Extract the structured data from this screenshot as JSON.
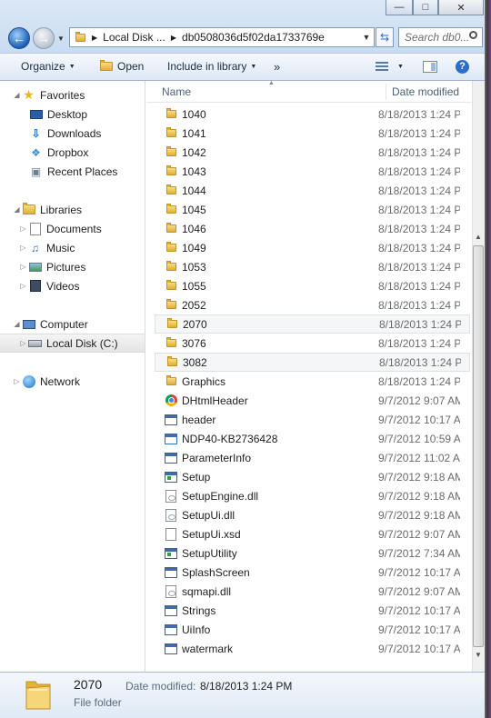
{
  "window": {
    "minimize_label": "—",
    "maximize_label": "□",
    "close_label": "✕"
  },
  "address": {
    "crumbs": [
      "Local Disk ...",
      "db0508036d5f02da1733769e"
    ],
    "separator": "▶",
    "refresh_icon": "⇆"
  },
  "search": {
    "placeholder": "Search db0..."
  },
  "toolbar": {
    "organize_label": "Organize",
    "open_label": "Open",
    "include_label": "Include in library",
    "more_label": "»"
  },
  "nav": {
    "favorites": {
      "label": "Favorites",
      "items": [
        "Desktop",
        "Downloads",
        "Dropbox",
        "Recent Places"
      ]
    },
    "libraries": {
      "label": "Libraries",
      "items": [
        "Documents",
        "Music",
        "Pictures",
        "Videos"
      ]
    },
    "computer": {
      "label": "Computer",
      "items": [
        "Local Disk (C:)"
      ]
    },
    "network": {
      "label": "Network"
    }
  },
  "columns": {
    "name": "Name",
    "date": "Date modified"
  },
  "files": [
    {
      "name": "1040",
      "date": "8/18/2013 1:24 P",
      "icon": "folder-icon"
    },
    {
      "name": "1041",
      "date": "8/18/2013 1:24 P",
      "icon": "folder-icon"
    },
    {
      "name": "1042",
      "date": "8/18/2013 1:24 P",
      "icon": "folder-icon"
    },
    {
      "name": "1043",
      "date": "8/18/2013 1:24 P",
      "icon": "folder-icon"
    },
    {
      "name": "1044",
      "date": "8/18/2013 1:24 P",
      "icon": "folder-icon"
    },
    {
      "name": "1045",
      "date": "8/18/2013 1:24 P",
      "icon": "folder-icon"
    },
    {
      "name": "1046",
      "date": "8/18/2013 1:24 P",
      "icon": "folder-icon"
    },
    {
      "name": "1049",
      "date": "8/18/2013 1:24 P",
      "icon": "folder-icon"
    },
    {
      "name": "1053",
      "date": "8/18/2013 1:24 P",
      "icon": "folder-icon"
    },
    {
      "name": "1055",
      "date": "8/18/2013 1:24 P",
      "icon": "folder-icon"
    },
    {
      "name": "2052",
      "date": "8/18/2013 1:24 P",
      "icon": "folder-icon"
    },
    {
      "name": "2070",
      "date": "8/18/2013 1:24 P",
      "icon": "folder-icon",
      "selected": true
    },
    {
      "name": "3076",
      "date": "8/18/2013 1:24 P",
      "icon": "folder-icon"
    },
    {
      "name": "3082",
      "date": "8/18/2013 1:24 P",
      "icon": "folder-icon",
      "hover": true
    },
    {
      "name": "Graphics",
      "date": "8/18/2013 1:24 P",
      "icon": "folder-icon"
    },
    {
      "name": "DHtmlHeader",
      "date": "9/7/2012 9:07 AM",
      "icon": "chrome-icon"
    },
    {
      "name": "header",
      "date": "9/7/2012 10:17 A",
      "icon": "image-icon"
    },
    {
      "name": "NDP40-KB2736428",
      "date": "9/7/2012 10:59 A",
      "icon": "installer-icon"
    },
    {
      "name": "ParameterInfo",
      "date": "9/7/2012 11:02 A",
      "icon": "document-icon"
    },
    {
      "name": "Setup",
      "date": "9/7/2012 9:18 AM",
      "icon": "application-icon"
    },
    {
      "name": "SetupEngine.dll",
      "date": "9/7/2012 9:18 AM",
      "icon": "dll-icon"
    },
    {
      "name": "SetupUi.dll",
      "date": "9/7/2012 9:18 AM",
      "icon": "dll-icon"
    },
    {
      "name": "SetupUi.xsd",
      "date": "9/7/2012 9:07 AM",
      "icon": "blank-document-icon"
    },
    {
      "name": "SetupUtility",
      "date": "9/7/2012 7:34 AM",
      "icon": "application-icon"
    },
    {
      "name": "SplashScreen",
      "date": "9/7/2012 10:17 A",
      "icon": "image-icon"
    },
    {
      "name": "sqmapi.dll",
      "date": "9/7/2012 9:07 AM",
      "icon": "dll-icon"
    },
    {
      "name": "Strings",
      "date": "9/7/2012 10:17 A",
      "icon": "document-icon"
    },
    {
      "name": "UiInfo",
      "date": "9/7/2012 10:17 A",
      "icon": "document-icon"
    },
    {
      "name": "watermark",
      "date": "9/7/2012 10:17 A",
      "icon": "image-icon"
    }
  ],
  "details": {
    "name": "2070",
    "date_label": "Date modified:",
    "date_value": "8/18/2013 1:24 PM",
    "type": "File folder"
  }
}
